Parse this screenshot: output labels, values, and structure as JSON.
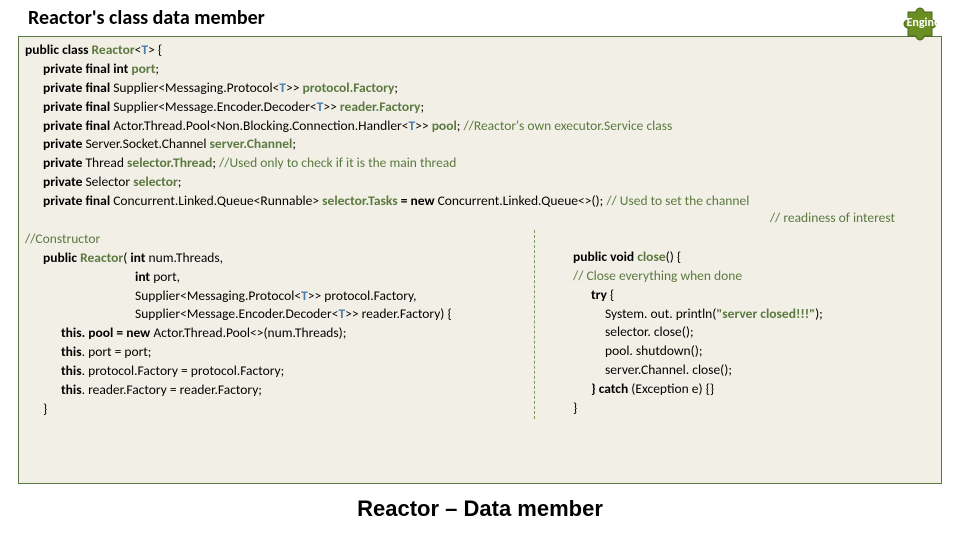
{
  "title": "Reactor's class data member",
  "engine_label": "Engine",
  "bottom_title": "Reactor – Data member",
  "decl": {
    "pub_class": "public class",
    "reactor": "Reactor",
    "t": "T",
    "priv_final": "private final",
    "priv": "private",
    "int_kw": "int",
    "port": "port",
    "supplier_proto": "Supplier<Messaging.Protocol<",
    "proto_close": ">>",
    "protocol_factory": "protocol.Factory",
    "supplier_enc": "Supplier<Message.Encoder.Decoder<",
    "reader_factory": "reader.Factory",
    "actor_pool": "Actor.Thread.Pool<Non.Blocking.Connection.Handler<",
    "pool": "pool",
    "pool_comment": "//Reactor's own executor.Service class",
    "server_socket": "Server.Socket.Channel",
    "server_channel": "server.Channel",
    "thread": "Thread",
    "selector_thread": "selector.Thread",
    "selector_thread_comment": "//Used only to check if it is the main thread",
    "selector_type": "Selector",
    "selector": "selector",
    "conc_queue": "Concurrent.Linked.Queue<Runnable>",
    "selector_tasks": "selector.Tasks",
    "equals_new": "= new",
    "conc_queue_inst": "Concurrent.Linked.Queue<>();",
    "tasks_comment": "// Used to set the  channel",
    "tasks_comment2": "// readiness of interest",
    "semicolon": ";"
  },
  "ctor": {
    "label": "//Constructor",
    "public": "public",
    "reactor": "Reactor",
    "int_kw": "int",
    "num_threads": "num.Threads,",
    "port": "port,",
    "supplier_proto": "Supplier<Messaging.Protocol<",
    "proto_close": ">> protocol.Factory,",
    "supplier_enc": "Supplier<Message.Encoder.Decoder<",
    "enc_close": ">> reader.Factory) {",
    "this": "this",
    "pool_assign": ". pool = new",
    "pool_inst": "Actor.Thread.Pool<>(num.Threads);",
    "port_assign": ". port = port;",
    "proto_assign": ". protocol.Factory = protocol.Factory;",
    "reader_assign": ". reader.Factory = reader.Factory;",
    "brace_close": "}"
  },
  "close": {
    "public_void": "public void",
    "close_name": "close",
    "comment": "// Close everything when done",
    "try_kw": "try",
    "system_out": "System. out",
    "println": ". println",
    "string": "\"server closed!!!\"",
    "selector_close": "selector. close();",
    "pool_shutdown": "pool. shutdown();",
    "server_close": "server.Channel. close();",
    "catch": "} catch",
    "catch_rest": "(Exception e) {}",
    "brace_close": "}"
  }
}
